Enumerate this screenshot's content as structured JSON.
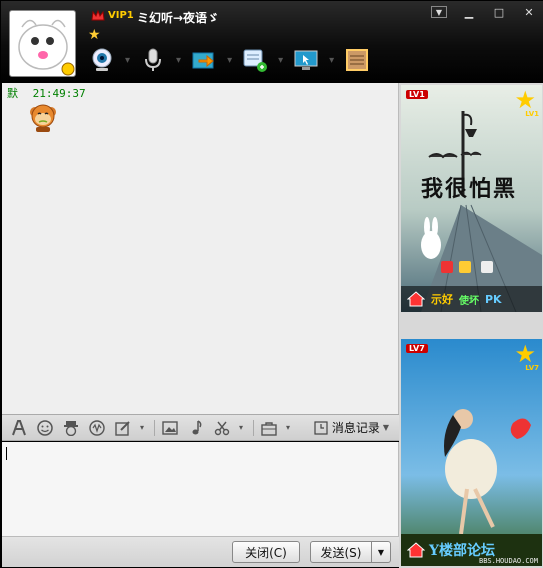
{
  "header": {
    "vip": "VIP1",
    "nickname": "ミ幻听→夜语ゞ",
    "window_buttons": [
      "menu-icon",
      "minimize-icon",
      "maximize-icon",
      "close-icon"
    ],
    "toolbar_icons": [
      "video-call-icon",
      "voice-call-icon",
      "send-file-icon",
      "sms-icon",
      "remote-assist-icon",
      "apps-icon"
    ]
  },
  "chat": {
    "message": {
      "sender": "默",
      "time": "21:49:37",
      "content": "emoticon-sad-face"
    }
  },
  "format_toolbar": {
    "icons": [
      "font-icon",
      "emoticon-icon",
      "magic-face-icon",
      "shake-icon",
      "handwrite-icon",
      "image-icon",
      "music-icon",
      "screenshot-icon",
      "bag-icon"
    ],
    "history_label": "消息记录"
  },
  "bottom": {
    "close_label": "关闭(C)",
    "send_label": "发送(S)"
  },
  "right_panel": {
    "show1": {
      "level": "LV1",
      "level_sub": "LV1",
      "title": "我很怕黑",
      "actions": [
        "示好",
        "使坏",
        "PK"
      ]
    },
    "show2": {
      "level": "LV7",
      "level_sub": "LV7",
      "banner_text": "Y楼部论坛",
      "url": "BBS.HOUDAO.COM"
    }
  }
}
